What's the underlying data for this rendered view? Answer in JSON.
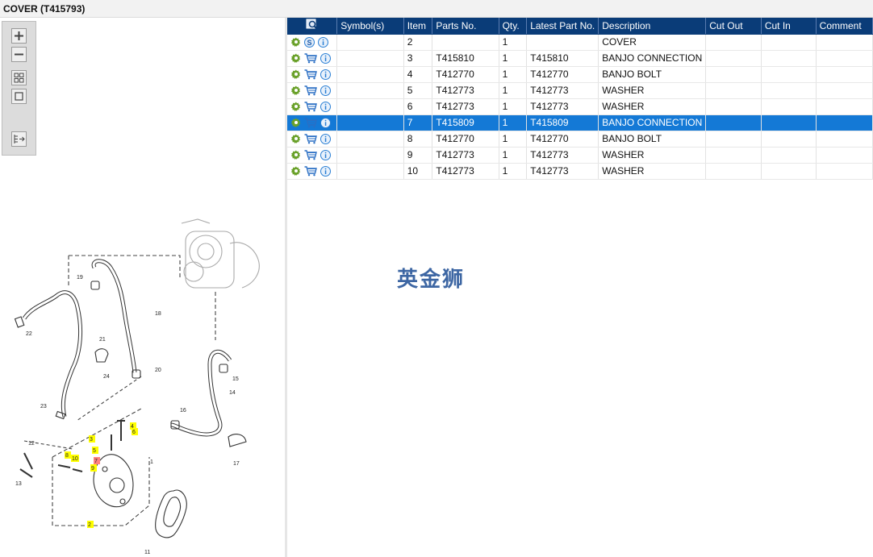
{
  "window": {
    "title": "COVER (T415793)"
  },
  "toolbox": {
    "tools": [
      "zoom-in-icon",
      "zoom-out-icon",
      "fit-page-icon",
      "actual-size-icon",
      "export-icon"
    ]
  },
  "diagram": {
    "callouts": [
      "19",
      "18",
      "22",
      "21",
      "24",
      "20",
      "15",
      "14",
      "23",
      "16",
      "4",
      "6",
      "3",
      "5",
      "12",
      "8",
      "10",
      "7",
      "9",
      "1",
      "17",
      "13",
      "2",
      "11"
    ]
  },
  "grid": {
    "columns": [
      "Symbol(s)",
      "Item",
      "Parts No.",
      "Qty.",
      "Latest Part No.",
      "Description",
      "Cut Out",
      "Cut In",
      "Comment"
    ],
    "rows": [
      {
        "item": "2",
        "parts_no": "",
        "qty": "1",
        "latest": "",
        "description": "COVER",
        "selected": false,
        "second_icon": "s-badge-icon"
      },
      {
        "item": "3",
        "parts_no": "T415810",
        "qty": "1",
        "latest": "T415810",
        "description": "BANJO CONNECTION",
        "selected": false,
        "second_icon": "cart-icon"
      },
      {
        "item": "4",
        "parts_no": "T412770",
        "qty": "1",
        "latest": "T412770",
        "description": "BANJO BOLT",
        "selected": false,
        "second_icon": "cart-icon"
      },
      {
        "item": "5",
        "parts_no": "T412773",
        "qty": "1",
        "latest": "T412773",
        "description": "WASHER",
        "selected": false,
        "second_icon": "cart-icon"
      },
      {
        "item": "6",
        "parts_no": "T412773",
        "qty": "1",
        "latest": "T412773",
        "description": "WASHER",
        "selected": false,
        "second_icon": "cart-icon"
      },
      {
        "item": "7",
        "parts_no": "T415809",
        "qty": "1",
        "latest": "T415809",
        "description": "BANJO CONNECTION",
        "selected": true,
        "second_icon": "cart-icon"
      },
      {
        "item": "8",
        "parts_no": "T412770",
        "qty": "1",
        "latest": "T412770",
        "description": "BANJO BOLT",
        "selected": false,
        "second_icon": "cart-icon"
      },
      {
        "item": "9",
        "parts_no": "T412773",
        "qty": "1",
        "latest": "T412773",
        "description": "WASHER",
        "selected": false,
        "second_icon": "cart-icon"
      },
      {
        "item": "10",
        "parts_no": "T412773",
        "qty": "1",
        "latest": "T412773",
        "description": "WASHER",
        "selected": false,
        "second_icon": "cart-icon"
      }
    ]
  },
  "watermark": {
    "text": "英金狮"
  },
  "colors": {
    "header": "#0a3c78",
    "selected_row": "#1479d6",
    "gear": "#6aa12a",
    "info": "#2a7fd4",
    "watermark": "#3d66a3"
  }
}
